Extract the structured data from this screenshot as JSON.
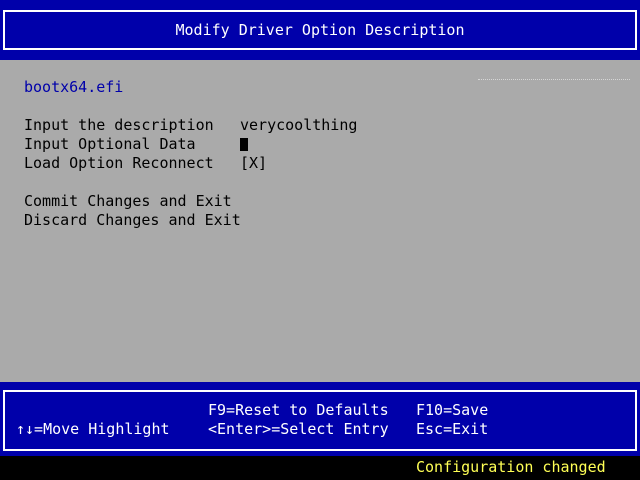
{
  "header": {
    "title": "Modify Driver Option Description"
  },
  "main": {
    "file_name": "bootx64.efi",
    "fields": {
      "description_label": "Input the description",
      "description_value": "verycoolthing",
      "optional_data_label": "Input Optional Data",
      "optional_data_value": "",
      "reconnect_label": "Load Option Reconnect",
      "reconnect_value": "[X]"
    },
    "actions": {
      "commit": "Commit Changes and Exit",
      "discard": "Discard Changes and Exit"
    }
  },
  "footer": {
    "move_highlight": "↑↓=Move Highlight",
    "reset_defaults": "F9=Reset to Defaults",
    "select_entry": "<Enter>=Select Entry",
    "save": "F10=Save",
    "exit": "Esc=Exit"
  },
  "status": {
    "message": "Configuration changed"
  },
  "colors": {
    "header_background": "#0000aa",
    "body_background": "#aaaaaa",
    "highlight_text": "#0000aa",
    "status_text": "#ffff55"
  }
}
